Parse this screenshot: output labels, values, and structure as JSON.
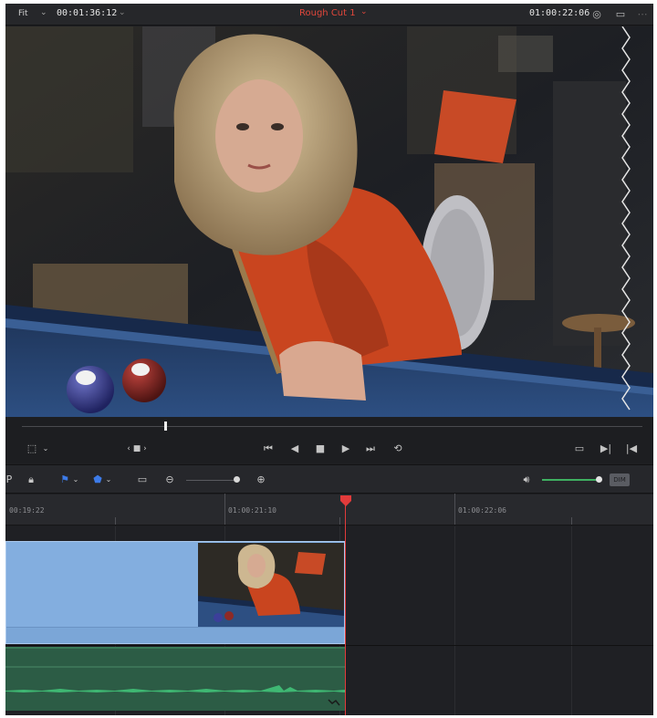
{
  "viewer_header": {
    "zoom_label": "Fit",
    "source_timecode": "00:01:36:12",
    "timeline_name": "Rough Cut 1",
    "record_timecode": "01:00:22:06"
  },
  "icons": {
    "dropdown": "chevron-down",
    "color": "color-wheel",
    "monitor": "monitor",
    "more": "ellipsis"
  },
  "transport": {
    "clip_nav": "‹ ■ ›"
  },
  "ruler": {
    "timecodes": [
      "00:19:22",
      "01:00:21:10",
      "01:00:22:06"
    ]
  },
  "toolbar": {
    "dim_label": "DIM"
  },
  "colors": {
    "accent_red": "#e2473b",
    "video_clip": "#83aedf",
    "audio_clip": "#2c5c45",
    "flag_blue": "#3d7be8",
    "volume_green": "#3fb061"
  }
}
